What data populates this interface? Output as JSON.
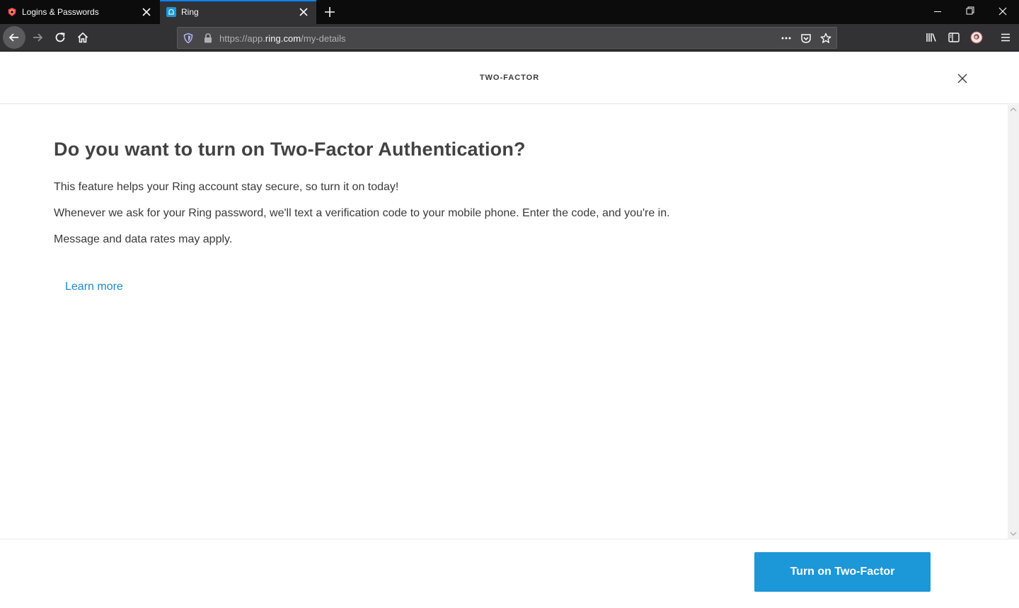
{
  "browser": {
    "tabs": [
      {
        "label": "Logins & Passwords",
        "favicon": "lockwise-icon",
        "active": false
      },
      {
        "label": "Ring",
        "favicon": "ring-bell-icon",
        "active": true
      }
    ],
    "url": {
      "prefix": "https://app.",
      "host": "ring.com",
      "path": "/my-details"
    },
    "accent": "#0a84ff"
  },
  "modal": {
    "header_title": "TWO-FACTOR",
    "heading": "Do you want to turn on Two-Factor Authentication?",
    "paragraphs": [
      "This feature helps your Ring account stay secure, so turn it on today!",
      "Whenever we ask for your Ring password, we'll text a verification code to your mobile phone. Enter the code, and you're in.",
      "Message and data rates may apply."
    ],
    "learn_more": "Learn more",
    "cta_label": "Turn on Two-Factor",
    "cta_color": "#1c97d8",
    "link_color": "#1b8ad0"
  }
}
